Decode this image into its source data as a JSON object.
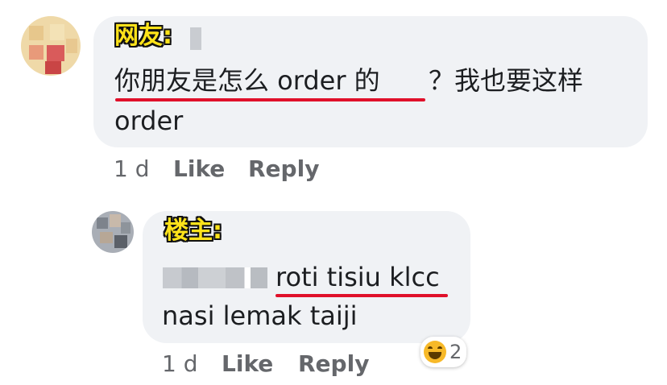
{
  "comment1": {
    "tag": "网友:",
    "text_underlined": "你朋友是怎么 order 的",
    "text_rest": "？我也要这样",
    "text_line2": "order",
    "time": "1 d",
    "like": "Like",
    "reply": "Reply"
  },
  "comment2": {
    "tag": "楼主:",
    "text_underlined": "roti tisiu klcc",
    "text_line2": "nasi lemak taiji",
    "time": "1 d",
    "like": "Like",
    "reply": "Reply",
    "reaction_icon": "laughing-emoji-icon",
    "reaction_count": "2"
  },
  "colors": {
    "bubble": "#f0f2f5",
    "underline": "#e0102a",
    "tag_fill": "#ffe31a",
    "meta_text": "#65676b"
  }
}
